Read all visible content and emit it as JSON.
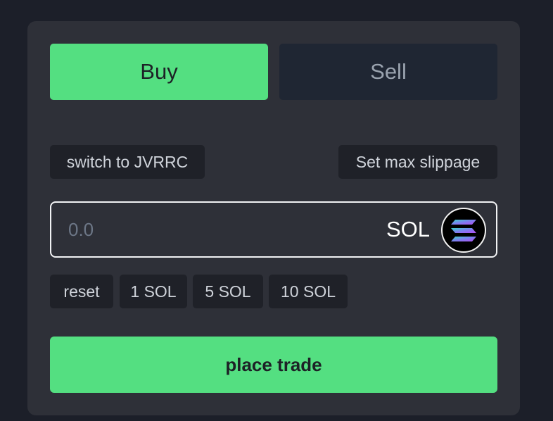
{
  "tabs": {
    "buy_label": "Buy",
    "sell_label": "Sell",
    "active": "buy"
  },
  "options": {
    "switch_label": "switch to JVRRC",
    "slippage_label": "Set max slippage"
  },
  "amount": {
    "value": "",
    "placeholder": "0.0",
    "currency": "SOL",
    "token_icon": "solana-icon"
  },
  "presets": [
    "reset",
    "1 SOL",
    "5 SOL",
    "10 SOL"
  ],
  "action": {
    "label": "place trade"
  },
  "colors": {
    "background": "#1c1f29",
    "panel": "#2e3038",
    "accent": "#54df81",
    "inactive_tab": "#1f2633",
    "chip": "#1f2128"
  }
}
